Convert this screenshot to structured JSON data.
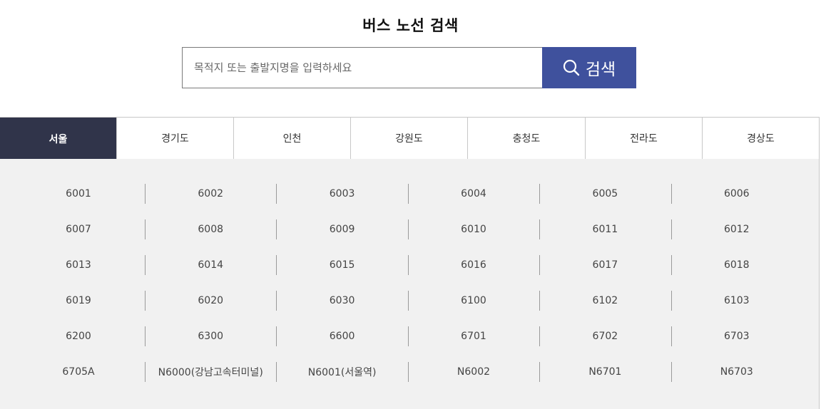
{
  "title": "버스 노선 검색",
  "search": {
    "placeholder": "목적지 또는 출발지명을 입력하세요",
    "button_label": "검색",
    "button_color": "#3f519d"
  },
  "tabs": [
    {
      "label": "서울",
      "active": true
    },
    {
      "label": "경기도",
      "active": false
    },
    {
      "label": "인천",
      "active": false
    },
    {
      "label": "강원도",
      "active": false
    },
    {
      "label": "충청도",
      "active": false
    },
    {
      "label": "전라도",
      "active": false
    },
    {
      "label": "경상도",
      "active": false
    }
  ],
  "active_tab_color": "#30344a",
  "routes": [
    [
      "6001",
      "6002",
      "6003",
      "6004",
      "6005",
      "6006"
    ],
    [
      "6007",
      "6008",
      "6009",
      "6010",
      "6011",
      "6012"
    ],
    [
      "6013",
      "6014",
      "6015",
      "6016",
      "6017",
      "6018"
    ],
    [
      "6019",
      "6020",
      "6030",
      "6100",
      "6102",
      "6103"
    ],
    [
      "6200",
      "6300",
      "6600",
      "6701",
      "6702",
      "6703"
    ],
    [
      "6705A",
      "N6000(강남고속터미널)",
      "N6001(서울역)",
      "N6002",
      "N6701",
      "N6703"
    ]
  ]
}
